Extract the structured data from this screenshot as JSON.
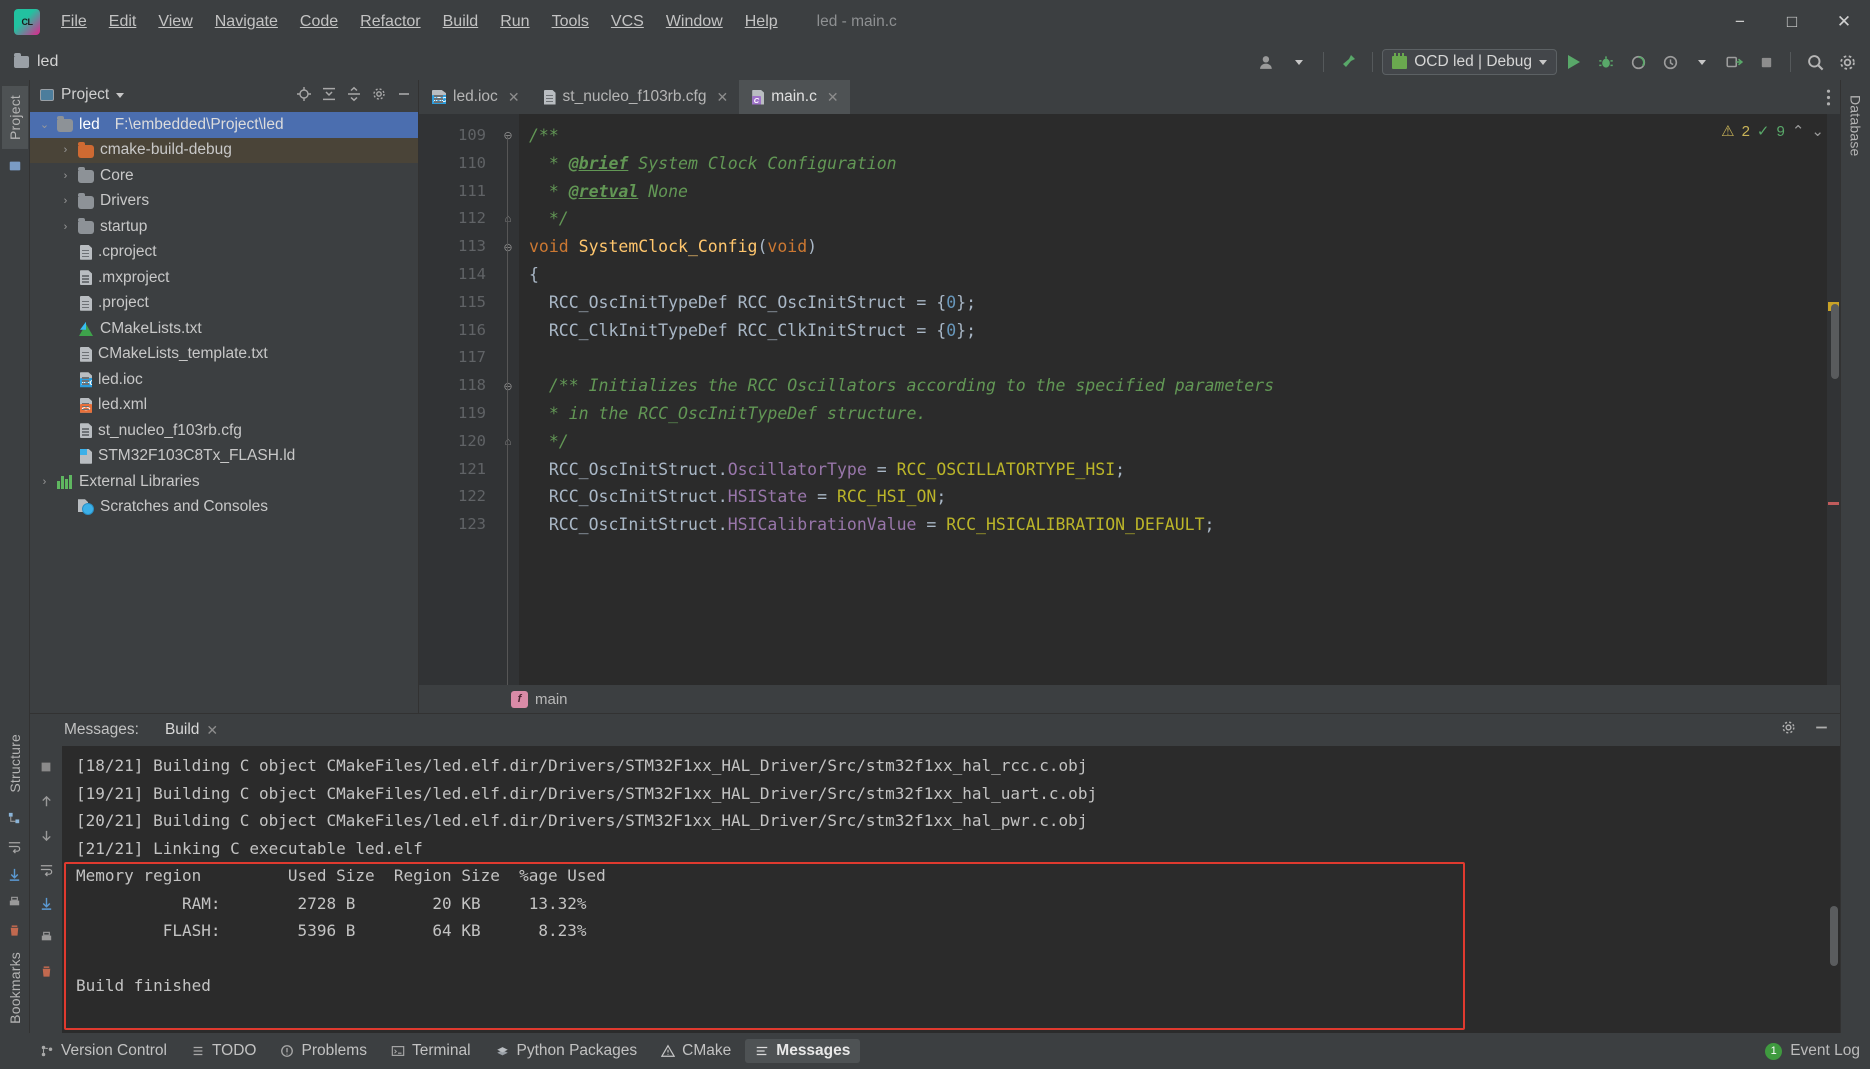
{
  "window": {
    "title": "led - main.c",
    "app_icon": "clion-logo-icon",
    "minimize": "−",
    "maximize": "□",
    "close": "✕"
  },
  "menu": [
    {
      "label": "File",
      "mnemonic": "F"
    },
    {
      "label": "Edit",
      "mnemonic": "E"
    },
    {
      "label": "View",
      "mnemonic": "V"
    },
    {
      "label": "Navigate",
      "mnemonic": "N"
    },
    {
      "label": "Code",
      "mnemonic": "C"
    },
    {
      "label": "Refactor",
      "mnemonic": "R"
    },
    {
      "label": "Build",
      "mnemonic": "B"
    },
    {
      "label": "Run",
      "mnemonic": "u"
    },
    {
      "label": "Tools",
      "mnemonic": "T"
    },
    {
      "label": "VCS",
      "mnemonic": "S"
    },
    {
      "label": "Window",
      "mnemonic": "W"
    },
    {
      "label": "Help",
      "mnemonic": "H"
    }
  ],
  "toolbar": {
    "project_name": "led",
    "run_config": "OCD led | Debug",
    "buttons": [
      "user-avatar-icon",
      "hammer-build-icon",
      "run-icon",
      "debug-icon",
      "attach-icon",
      "profile-icon",
      "dropdown-icon",
      "run-to-cursor-icon",
      "stop-icon",
      "search-everywhere-icon",
      "settings-gear-icon"
    ]
  },
  "left_tool_window": {
    "tabs": [
      "Project",
      "Structure",
      "Bookmarks"
    ]
  },
  "right_tool_window": {
    "tabs": [
      "Database"
    ]
  },
  "project_panel": {
    "title": "Project",
    "actions": [
      "locate-target-icon",
      "collapse-expand-icon",
      "collapse-all-icon",
      "settings-gear-icon",
      "hide-icon"
    ],
    "tree": [
      {
        "label": "led",
        "path": "F:\\embedded\\Project\\led",
        "icon": "folder-icon",
        "arrow": "⌄",
        "indent": 0,
        "state": "selected"
      },
      {
        "label": "cmake-build-debug",
        "icon": "folder-orange-icon",
        "arrow": "›",
        "indent": 1,
        "state": "highlighted"
      },
      {
        "label": "Core",
        "icon": "folder-icon",
        "arrow": "›",
        "indent": 1,
        "state": "normal"
      },
      {
        "label": "Drivers",
        "icon": "folder-icon",
        "arrow": "›",
        "indent": 1,
        "state": "normal"
      },
      {
        "label": "startup",
        "icon": "folder-icon",
        "arrow": "›",
        "indent": 1,
        "state": "normal"
      },
      {
        "label": ".cproject",
        "icon": "file-icon",
        "arrow": "",
        "indent": 2,
        "state": "normal"
      },
      {
        "label": ".mxproject",
        "icon": "file-icon",
        "arrow": "",
        "indent": 2,
        "state": "normal"
      },
      {
        "label": ".project",
        "icon": "file-icon",
        "arrow": "",
        "indent": 2,
        "state": "normal"
      },
      {
        "label": "CMakeLists.txt",
        "icon": "cmake-icon",
        "arrow": "",
        "indent": 2,
        "state": "normal"
      },
      {
        "label": "CMakeLists_template.txt",
        "icon": "file-icon",
        "arrow": "",
        "indent": 2,
        "state": "normal"
      },
      {
        "label": "led.ioc",
        "icon": "ioc-file-icon",
        "arrow": "",
        "indent": 2,
        "state": "normal"
      },
      {
        "label": "led.xml",
        "icon": "xml-file-icon",
        "arrow": "",
        "indent": 2,
        "state": "normal"
      },
      {
        "label": "st_nucleo_f103rb.cfg",
        "icon": "file-icon",
        "arrow": "",
        "indent": 2,
        "state": "normal"
      },
      {
        "label": "STM32F103C8Tx_FLASH.ld",
        "icon": "ld-file-icon",
        "arrow": "",
        "indent": 2,
        "state": "normal"
      },
      {
        "label": "External Libraries",
        "icon": "library-icon",
        "arrow": "›",
        "indent": 0,
        "state": "normal"
      },
      {
        "label": "Scratches and Consoles",
        "icon": "scratches-icon",
        "arrow": "",
        "indent": 1,
        "state": "normal"
      }
    ]
  },
  "editor": {
    "tabs": [
      {
        "label": "led.ioc",
        "icon": "ioc-file-icon",
        "active": false,
        "close": "✕"
      },
      {
        "label": "st_nucleo_f103rb.cfg",
        "icon": "file-icon",
        "active": false,
        "close": "✕"
      },
      {
        "label": "main.c",
        "icon": "c-file-icon",
        "active": true,
        "close": "✕"
      }
    ],
    "inspections": {
      "warnings": "2",
      "checks": "9",
      "warning_icon": "warning-triangle-icon",
      "check_icon": "inspection-check-icon",
      "up": "⌃",
      "down": "⌄"
    },
    "breadcrumb": "main",
    "breadcrumb_badge": "f",
    "lines": [
      {
        "num": "109",
        "fold": "⊖",
        "text": "/**",
        "marker": ""
      },
      {
        "num": "110",
        "fold": "",
        "text": "  * @brief System Clock Configuration",
        "marker": ""
      },
      {
        "num": "111",
        "fold": "",
        "text": "  * @retval None",
        "marker": ""
      },
      {
        "num": "112",
        "fold": "⌂",
        "text": "  */",
        "marker": ""
      },
      {
        "num": "113",
        "fold": "⊖",
        "text": "void SystemClock_Config(void)",
        "marker": "override-icon"
      },
      {
        "num": "114",
        "fold": "",
        "text": "{",
        "marker": ""
      },
      {
        "num": "115",
        "fold": "",
        "text": "  RCC_OscInitTypeDef RCC_OscInitStruct = {0};",
        "marker": ""
      },
      {
        "num": "116",
        "fold": "",
        "text": "  RCC_ClkInitTypeDef RCC_ClkInitStruct = {0};",
        "marker": ""
      },
      {
        "num": "117",
        "fold": "",
        "text": "",
        "marker": ""
      },
      {
        "num": "118",
        "fold": "⊖",
        "text": "  /** Initializes the RCC Oscillators according to the specified parameters",
        "marker": ""
      },
      {
        "num": "119",
        "fold": "",
        "text": "  * in the RCC_OscInitTypeDef structure.",
        "marker": ""
      },
      {
        "num": "120",
        "fold": "⌂",
        "text": "  */",
        "marker": ""
      },
      {
        "num": "121",
        "fold": "",
        "text": "  RCC_OscInitStruct.OscillatorType = RCC_OSCILLATORTYPE_HSI;",
        "marker": ""
      },
      {
        "num": "122",
        "fold": "",
        "text": "  RCC_OscInitStruct.HSIState = RCC_HSI_ON;",
        "marker": ""
      },
      {
        "num": "123",
        "fold": "",
        "text": "  RCC_OscInitStruct.HSICalibrationValue = RCC_HSICALIBRATION_DEFAULT;",
        "marker": ""
      }
    ]
  },
  "messages": {
    "label": "Messages:",
    "tab": "Build",
    "close": "✕",
    "toolbar_right": [
      "settings-gear-icon",
      "hide-icon"
    ],
    "side_tools": [
      "stop-icon",
      "arrow-up-icon",
      "arrow-down-icon",
      "wrap-icon",
      "scroll-to-end-icon",
      "print-icon",
      "trash-icon"
    ],
    "console_lines": [
      "[18/21] Building C object CMakeFiles/led.elf.dir/Drivers/STM32F1xx_HAL_Driver/Src/stm32f1xx_hal_rcc.c.obj",
      "[19/21] Building C object CMakeFiles/led.elf.dir/Drivers/STM32F1xx_HAL_Driver/Src/stm32f1xx_hal_uart.c.obj",
      "[20/21] Building C object CMakeFiles/led.elf.dir/Drivers/STM32F1xx_HAL_Driver/Src/stm32f1xx_hal_pwr.c.obj",
      "[21/21] Linking C executable led.elf",
      "Memory region         Used Size  Region Size  %age Used",
      "           RAM:        2728 B        20 KB     13.32%",
      "         FLASH:        5396 B        64 KB      8.23%",
      "",
      "Build finished"
    ],
    "highlight_color": "#e03a2f",
    "memory_table": {
      "headers": [
        "Memory region",
        "Used Size",
        "Region Size",
        "%age Used"
      ],
      "rows": [
        {
          "region": "RAM:",
          "used": "2728 B",
          "size": "20 KB",
          "pct": "13.32%"
        },
        {
          "region": "FLASH:",
          "used": "5396 B",
          "size": "64 KB",
          "pct": "8.23%"
        }
      ]
    },
    "build_status": "Build finished"
  },
  "status_bar": {
    "items": [
      {
        "label": "Version Control",
        "icon": "branch-icon"
      },
      {
        "label": "TODO",
        "icon": "todo-list-icon"
      },
      {
        "label": "Problems",
        "icon": "problems-icon"
      },
      {
        "label": "Terminal",
        "icon": "terminal-icon"
      },
      {
        "label": "Python Packages",
        "icon": "python-packages-icon"
      },
      {
        "label": "CMake",
        "icon": "cmake-warning-icon"
      },
      {
        "label": "Messages",
        "icon": "messages-icon",
        "active": true
      }
    ],
    "event_log": {
      "label": "Event Log",
      "count": "1"
    }
  },
  "colors": {
    "accent_blue": "#4b6eaf",
    "comment_green": "#629755",
    "keyword_orange": "#cc7832",
    "function_yellow": "#ffc66d",
    "field_purple": "#9876aa",
    "macro_olive": "#bbb529",
    "number_blue": "#6897bb",
    "error_red": "#e03a2f",
    "run_green": "#59a869"
  }
}
